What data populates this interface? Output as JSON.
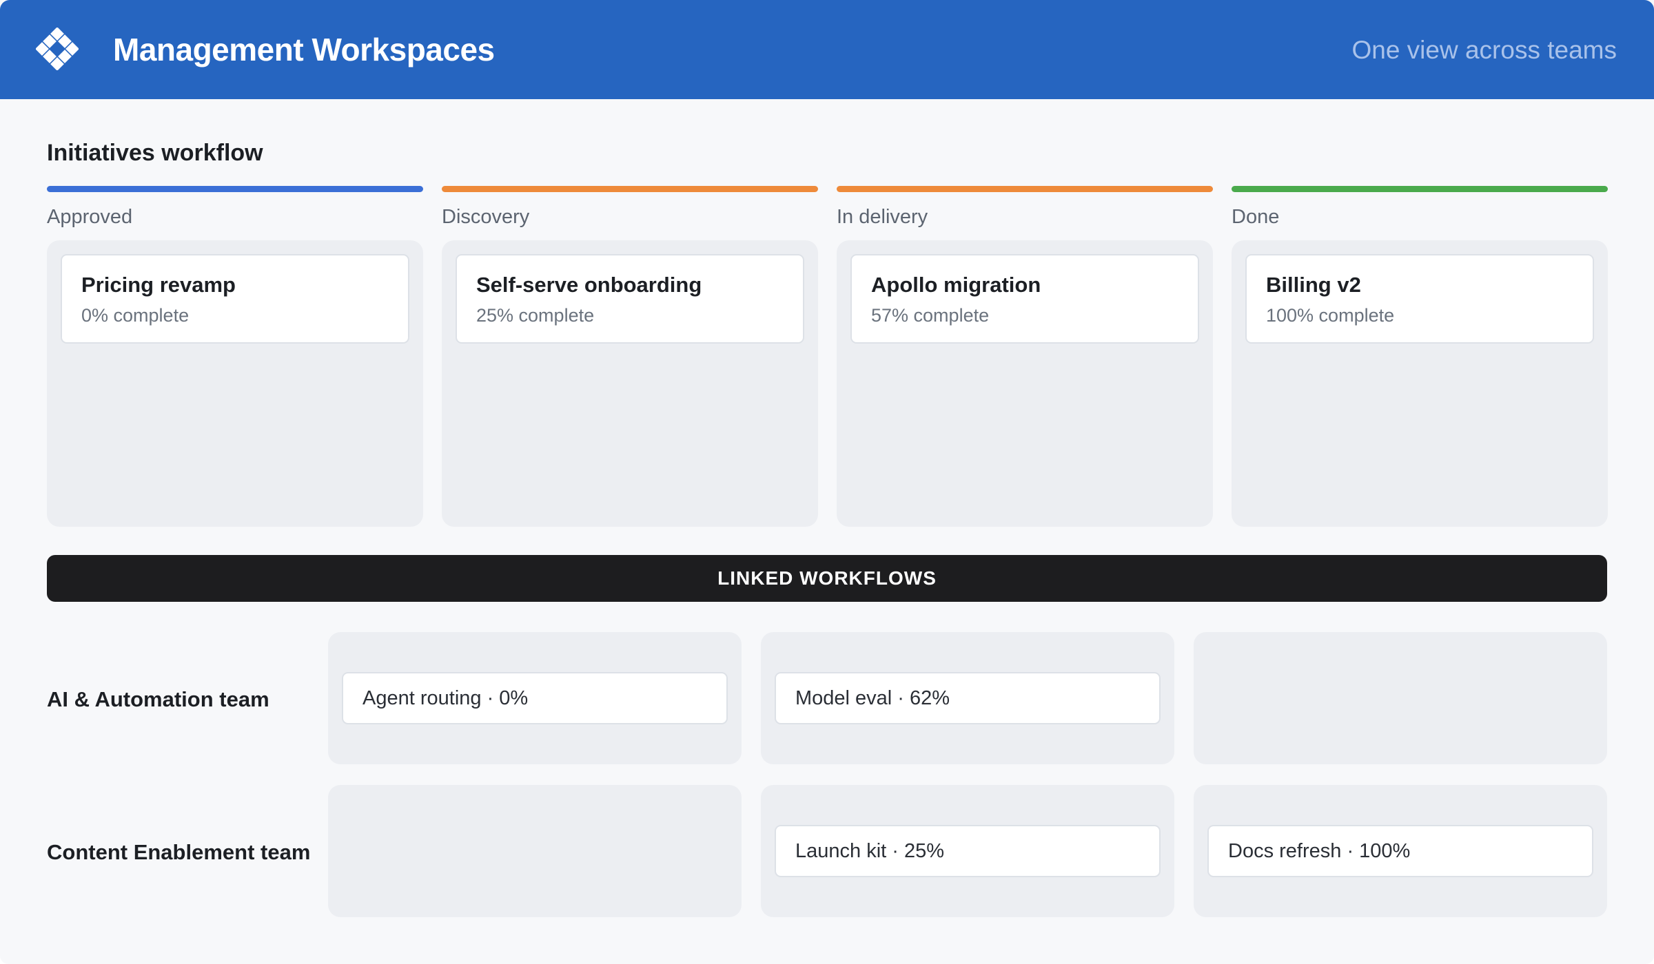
{
  "header": {
    "title": "Management Workspaces",
    "tagline": "One view across teams",
    "logo_icon": "diamond-grid-icon",
    "background": "#2665c0"
  },
  "workflow": {
    "title": "Initiatives workflow",
    "stages": [
      {
        "name": "Approved",
        "color": "#3b6fd6",
        "card": {
          "title": "Pricing revamp",
          "progress": "0% complete"
        }
      },
      {
        "name": "Discovery",
        "color": "#ee8a3a",
        "card": {
          "title": "Self-serve onboarding",
          "progress": "25% complete"
        }
      },
      {
        "name": "In delivery",
        "color": "#ee8a3a",
        "card": {
          "title": "Apollo migration",
          "progress": "57% complete"
        }
      },
      {
        "name": "Done",
        "color": "#4aaa4c",
        "card": {
          "title": "Billing v2",
          "progress": "100% complete"
        }
      }
    ]
  },
  "linked": {
    "title": "LINKED WORKFLOWS",
    "teams": [
      {
        "name": "AI & Automation team",
        "cells": [
          "Agent routing · 0%",
          "Model eval · 62%",
          ""
        ]
      },
      {
        "name": "Content Enablement team",
        "cells": [
          "",
          "Launch kit · 25%",
          "Docs refresh · 100%"
        ]
      }
    ]
  }
}
